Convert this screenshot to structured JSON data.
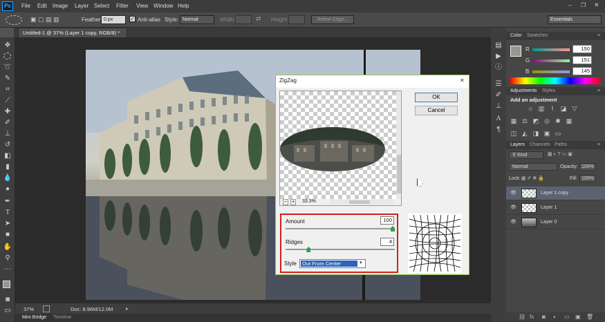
{
  "app": {
    "logo": "Ps"
  },
  "menu": [
    "File",
    "Edit",
    "Image",
    "Layer",
    "Select",
    "Filter",
    "View",
    "Window",
    "Help"
  ],
  "options_bar": {
    "feather_label": "Feather:",
    "feather_value": "0 px",
    "antialias_label": "Anti-alias",
    "style_label": "Style:",
    "style_value": "Normal",
    "width_label": "Width:",
    "height_label": "Height:",
    "refine_edge": "Refine Edge...",
    "workspace": "Essentials"
  },
  "document": {
    "tab_title": "Untitled-1 @ 37% (Layer 1 copy, RGB/8) *",
    "close": "×"
  },
  "status": {
    "zoom": "37%",
    "doc_size": "Doc: 8.96M/12.0M"
  },
  "bottom_tabs": [
    "Mini Bridge",
    "Timeline"
  ],
  "dialog": {
    "title": "ZigZag",
    "close": "✕",
    "ok": "OK",
    "cancel": "Cancel",
    "zoom": "33.3%",
    "zoom_minus": "−",
    "zoom_plus": "+",
    "amount_label": "Amount",
    "amount_value": "100",
    "ridges_label": "Ridges",
    "ridges_value": "4",
    "style_label": "Style",
    "style_value": "Out From Center",
    "amount_level": 1.0,
    "ridges_level": 0.2
  },
  "color_panel": {
    "tabs": [
      "Color",
      "Swatches"
    ],
    "channels": [
      {
        "name": "R",
        "value": "150"
      },
      {
        "name": "G",
        "value": "151"
      },
      {
        "name": "B",
        "value": "145"
      }
    ],
    "foreground": "#969791"
  },
  "adjustments_panel": {
    "tabs": [
      "Adjustments",
      "Styles"
    ],
    "heading": "Add an adjustment"
  },
  "layers_panel": {
    "tabs": [
      "Layers",
      "Channels",
      "Paths"
    ],
    "filter_label": "Kind",
    "blend_mode": "Normal",
    "opacity_label": "Opacity:",
    "opacity_value": "100%",
    "lock_label": "Lock:",
    "fill_label": "Fill:",
    "fill_value": "100%",
    "layers": [
      {
        "name": "Layer 1 copy",
        "selected": true
      },
      {
        "name": "Layer 1",
        "selected": false
      },
      {
        "name": "Layer 0",
        "selected": false
      }
    ]
  },
  "colors": {
    "accent": "#2e62b8",
    "highlight_box": "#d21f1f",
    "dialog_border": "#8fc34a"
  }
}
